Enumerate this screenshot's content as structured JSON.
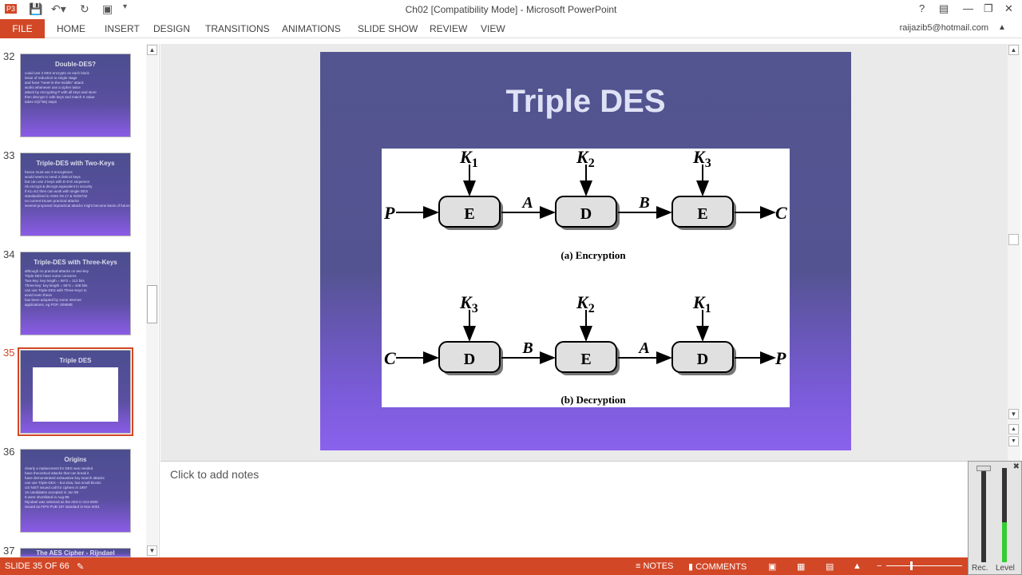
{
  "window": {
    "title": "Ch02 [Compatibility Mode] - Microsoft PowerPoint",
    "user": "raijazib5@hotmail.com"
  },
  "ribbon": {
    "file": "FILE",
    "tabs": [
      "HOME",
      "INSERT",
      "DESIGN",
      "TRANSITIONS",
      "ANIMATIONS",
      "SLIDE SHOW",
      "REVIEW",
      "VIEW"
    ]
  },
  "thumbnails": [
    {
      "num": "32",
      "title": "Double-DES?",
      "bullets": [
        "could use 2 DES encrypts on each block",
        "issue of reduction to single stage",
        "and have \"meet-in-the-middle\" attack",
        "works whenever use a cipher twice",
        "attack by encrypting P with all keys and store",
        "then decrypt C with keys and match X value",
        "takes O(2^56) steps"
      ]
    },
    {
      "num": "33",
      "title": "Triple-DES with Two-Keys",
      "bullets": [
        "hence must use 3 encryptions",
        "would seem to need 3 distinct keys",
        "but can use 2 keys with E-D-E sequence",
        "nb encrypt & decrypt equivalent in security",
        "if K1=K2 then can work with single DES",
        "standardized in ANSI X9.17 & ISO8732",
        "no current known practical attacks",
        "several proposed impractical attacks might become basis of future attacks"
      ]
    },
    {
      "num": "34",
      "title": "Triple-DES with Three-Keys",
      "bullets": [
        "although no practical attacks on two-key",
        "Triple-DES have some concerns",
        "Two-key: key length = 56*2 = 112 bits",
        "Three-key: key length = 56*3 = 168 bits",
        "can use Triple-DES with Three-Keys to",
        "avoid even these",
        "has been adopted by some Internet",
        "applications, eg PGP, S/MIME"
      ]
    },
    {
      "num": "35",
      "title": "Triple DES",
      "bullets": []
    },
    {
      "num": "36",
      "title": "Origins",
      "bullets": [
        "clearly a replacement for DES was needed",
        "have theoretical attacks that can break it",
        "have demonstrated exhaustive key search attacks",
        "can use Triple-DES – but slow, has small blocks",
        "US NIST issued call for ciphers in 1997",
        "15 candidates accepted in Jun 98",
        "5 were shortlisted in Aug-99",
        "Rijndael was selected as the AES in Oct-2000",
        "issued as FIPS PUB 197 standard in Nov-2001"
      ]
    },
    {
      "num": "37",
      "title": "The AES Cipher - Rijndael",
      "bullets": []
    }
  ],
  "slide": {
    "title": "Triple DES",
    "encryption": {
      "input": "P",
      "output": "C",
      "boxes": [
        "E",
        "D",
        "E"
      ],
      "keys": [
        "K1",
        "K2",
        "K3"
      ],
      "mid": [
        "A",
        "B"
      ],
      "caption": "(a) Encryption"
    },
    "decryption": {
      "input": "C",
      "output": "P",
      "boxes": [
        "D",
        "E",
        "D"
      ],
      "keys": [
        "K3",
        "K2",
        "K1"
      ],
      "mid": [
        "B",
        "A"
      ],
      "caption": "(b) Decryption"
    }
  },
  "notes": {
    "placeholder": "Click to add notes"
  },
  "status": {
    "slide": "SLIDE 35 OF 66",
    "notes": "NOTES",
    "comments": "COMMENTS"
  },
  "recorder": {
    "rec": "Rec.",
    "level": "Level"
  }
}
